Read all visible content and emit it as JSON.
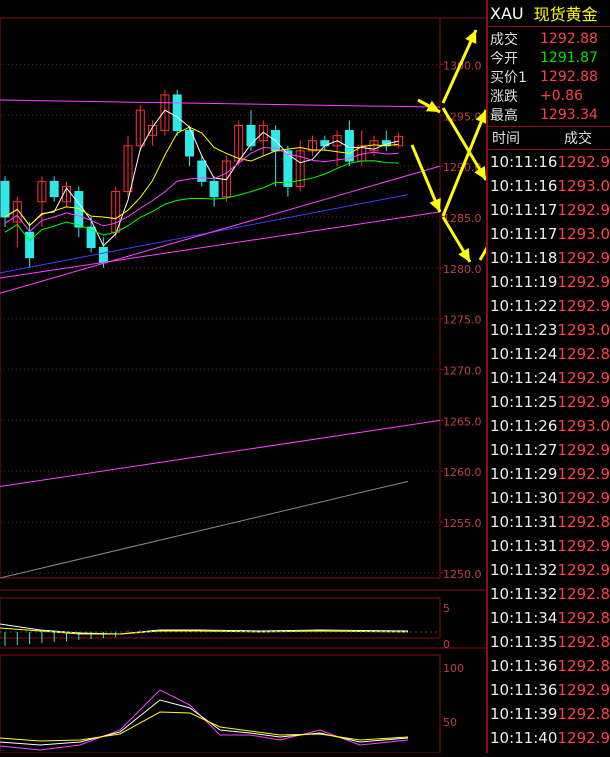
{
  "header": {
    "symbol": "XAU",
    "name": "现货黄金"
  },
  "quotes": [
    {
      "label": "成交",
      "value": "1292.88",
      "color": "red"
    },
    {
      "label": "今开",
      "value": "1291.87",
      "color": "green"
    },
    {
      "label": "买价1",
      "value": "1292.88",
      "color": "red"
    },
    {
      "label": "涨跌",
      "value": "+0.86",
      "color": "red"
    },
    {
      "label": "最高",
      "value": "1293.34",
      "color": "red"
    }
  ],
  "ticks_header": {
    "time": "时间",
    "price": "成交"
  },
  "ticks": [
    {
      "time": "10:11:16",
      "price": "1292.9"
    },
    {
      "time": "10:11:16",
      "price": "1293.0"
    },
    {
      "time": "10:11:17",
      "price": "1292.9"
    },
    {
      "time": "10:11:17",
      "price": "1293.0"
    },
    {
      "time": "10:11:18",
      "price": "1292.9"
    },
    {
      "time": "10:11:19",
      "price": "1292.9"
    },
    {
      "time": "10:11:22",
      "price": "1292.9"
    },
    {
      "time": "10:11:23",
      "price": "1293.0"
    },
    {
      "time": "10:11:24",
      "price": "1292.8"
    },
    {
      "time": "10:11:24",
      "price": "1292.9"
    },
    {
      "time": "10:11:25",
      "price": "1292.9"
    },
    {
      "time": "10:11:26",
      "price": "1293.0"
    },
    {
      "time": "10:11:27",
      "price": "1292.9"
    },
    {
      "time": "10:11:29",
      "price": "1292.9"
    },
    {
      "time": "10:11:30",
      "price": "1292.9"
    },
    {
      "time": "10:11:31",
      "price": "1292.8"
    },
    {
      "time": "10:11:31",
      "price": "1292.9"
    },
    {
      "time": "10:11:32",
      "price": "1292.9"
    },
    {
      "time": "10:11:32",
      "price": "1292.8"
    },
    {
      "time": "10:11:34",
      "price": "1292.8"
    },
    {
      "time": "10:11:35",
      "price": "1292.8"
    },
    {
      "time": "10:11:36",
      "price": "1292.8"
    },
    {
      "time": "10:11:36",
      "price": "1292.9"
    },
    {
      "time": "10:11:39",
      "price": "1292.8"
    },
    {
      "time": "10:11:40",
      "price": "1292.9"
    }
  ],
  "price_axis": [
    "1300.0",
    "1295.0",
    "1290.0",
    "1285.0",
    "1280.0",
    "1275.0",
    "1270.0",
    "1265.0",
    "1260.0",
    "1255.0",
    "1250.0"
  ],
  "macd_axis": [
    "5",
    "0"
  ],
  "kdj_axis": [
    "100",
    "50"
  ],
  "candles": [
    {
      "o": 1288.5,
      "c": 1285.0,
      "h": 1289.0,
      "l": 1284.0
    },
    {
      "o": 1284.5,
      "c": 1286.5,
      "h": 1287.0,
      "l": 1282.0
    },
    {
      "o": 1283.5,
      "c": 1281.0,
      "h": 1284.5,
      "l": 1280.0
    },
    {
      "o": 1286.5,
      "c": 1288.5,
      "h": 1289.0,
      "l": 1284.0
    },
    {
      "o": 1288.5,
      "c": 1287.0,
      "h": 1289.0,
      "l": 1286.5
    },
    {
      "o": 1286.5,
      "c": 1288.0,
      "h": 1288.5,
      "l": 1286.0
    },
    {
      "o": 1287.5,
      "c": 1284.0,
      "h": 1288.0,
      "l": 1283.0
    },
    {
      "o": 1284.0,
      "c": 1282.0,
      "h": 1285.0,
      "l": 1281.5
    },
    {
      "o": 1282.0,
      "c": 1280.5,
      "h": 1283.0,
      "l": 1280.0
    },
    {
      "o": 1283.5,
      "c": 1287.5,
      "h": 1288.0,
      "l": 1283.0
    },
    {
      "o": 1287.5,
      "c": 1292.0,
      "h": 1293.0,
      "l": 1287.0
    },
    {
      "o": 1292.0,
      "c": 1295.5,
      "h": 1296.0,
      "l": 1291.5
    },
    {
      "o": 1293.0,
      "c": 1294.0,
      "h": 1294.5,
      "l": 1292.0
    },
    {
      "o": 1293.5,
      "c": 1297.0,
      "h": 1297.5,
      "l": 1293.0
    },
    {
      "o": 1297.0,
      "c": 1293.5,
      "h": 1297.5,
      "l": 1293.0
    },
    {
      "o": 1293.5,
      "c": 1291.0,
      "h": 1294.0,
      "l": 1290.0
    },
    {
      "o": 1290.5,
      "c": 1288.5,
      "h": 1291.0,
      "l": 1288.0
    },
    {
      "o": 1288.5,
      "c": 1287.0,
      "h": 1289.0,
      "l": 1286.0
    },
    {
      "o": 1287.0,
      "c": 1290.5,
      "h": 1291.0,
      "l": 1286.5
    },
    {
      "o": 1290.5,
      "c": 1294.0,
      "h": 1294.5,
      "l": 1290.0
    },
    {
      "o": 1294.0,
      "c": 1292.0,
      "h": 1295.5,
      "l": 1291.5
    },
    {
      "o": 1292.5,
      "c": 1294.0,
      "h": 1294.5,
      "l": 1291.0
    },
    {
      "o": 1293.5,
      "c": 1291.5,
      "h": 1294.0,
      "l": 1288.0
    },
    {
      "o": 1291.5,
      "c": 1288.0,
      "h": 1292.0,
      "l": 1287.0
    },
    {
      "o": 1288.0,
      "c": 1291.5,
      "h": 1292.5,
      "l": 1287.5
    },
    {
      "o": 1291.5,
      "c": 1292.5,
      "h": 1293.0,
      "l": 1291.0
    },
    {
      "o": 1292.5,
      "c": 1292.0,
      "h": 1293.0,
      "l": 1291.5
    },
    {
      "o": 1292.0,
      "c": 1293.0,
      "h": 1293.5,
      "l": 1290.0
    },
    {
      "o": 1293.5,
      "c": 1290.5,
      "h": 1294.5,
      "l": 1290.0
    },
    {
      "o": 1290.5,
      "c": 1292.0,
      "h": 1293.5,
      "l": 1290.0
    },
    {
      "o": 1291.5,
      "c": 1292.5,
      "h": 1293.0,
      "l": 1291.0
    },
    {
      "o": 1292.5,
      "c": 1292.0,
      "h": 1293.5,
      "l": 1291.5
    },
    {
      "o": 1292.0,
      "c": 1292.9,
      "h": 1293.3,
      "l": 1291.8
    }
  ],
  "colors": {
    "up": "#ff3030",
    "down": "#30e8e8",
    "grid": "#8a1010",
    "ma5": "#ffffff",
    "ma10": "#ffff00",
    "ma20": "#ff40ff",
    "ma60": "#00ff00",
    "ma120": "#4040ff",
    "trend": "#ff40ff",
    "annotation": "#ffff00"
  }
}
